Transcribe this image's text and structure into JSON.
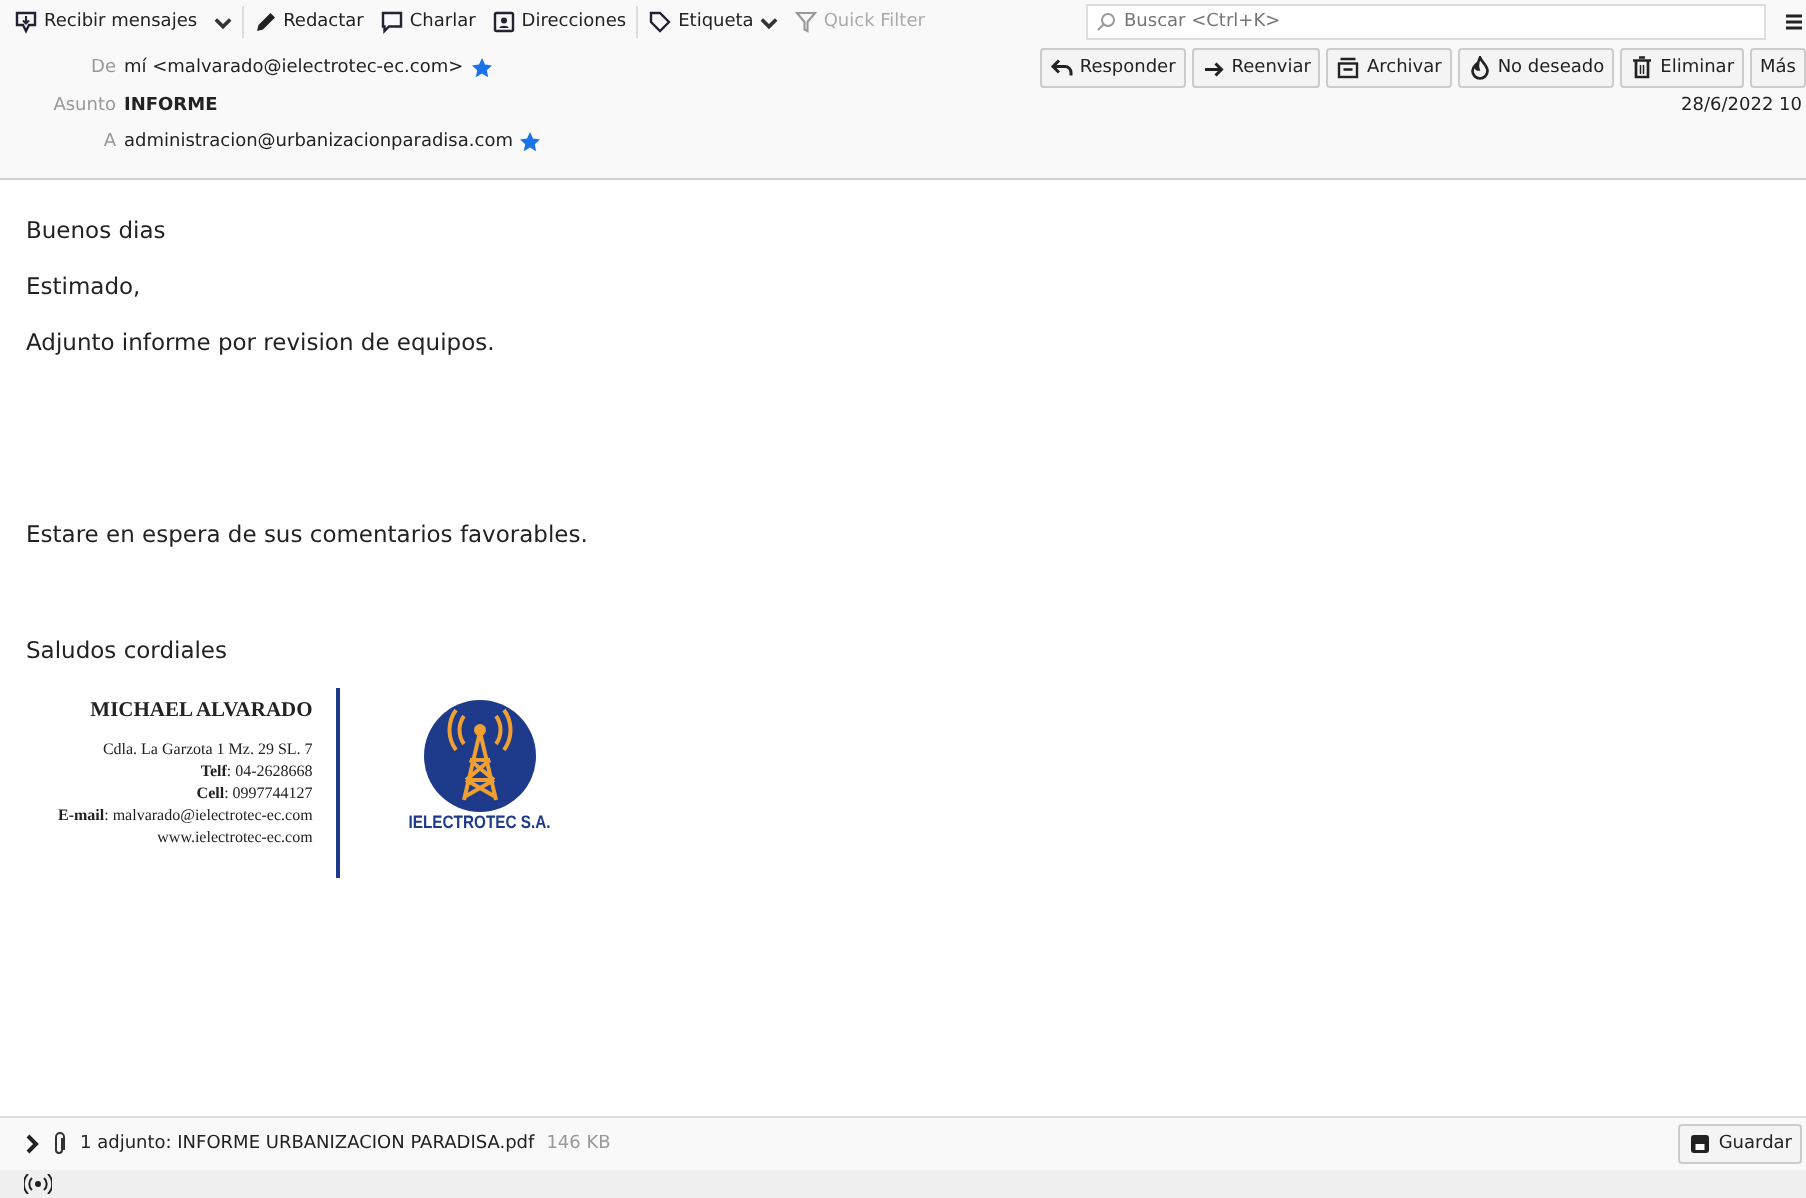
{
  "toolbar": {
    "buttons": [
      {
        "kind": "get",
        "label": "Recibir mensajes"
      },
      {
        "kind": "dropdown"
      },
      {
        "kind": "compose",
        "label": "Redactar"
      },
      {
        "kind": "chat",
        "label": "Charlar"
      },
      {
        "kind": "contacts",
        "label": "Direcciones"
      },
      {
        "kind": "tag",
        "label": "Etiqueta"
      },
      {
        "kind": "filter",
        "label": "Quick Filter"
      }
    ],
    "search": {
      "placeholder": "Buscar <Ctrl+K>"
    }
  },
  "header": {
    "from_label": "De",
    "from": "mí <malvarado@ielectrotec-ec.com>",
    "subject_label": "Asunto",
    "subject": "INFORME",
    "to_label": "A",
    "to": "administracion@urbanizacionparadisa.com",
    "date": "28/6/2022 10",
    "actions": [
      {
        "kind": "reply",
        "label": "Responder"
      },
      {
        "kind": "forward",
        "label": "Reenviar"
      },
      {
        "kind": "archive",
        "label": "Archivar"
      },
      {
        "kind": "junk",
        "label": "No deseado"
      },
      {
        "kind": "delete",
        "label": "Eliminar"
      },
      {
        "kind": "more",
        "label": "Más"
      }
    ]
  },
  "body": [
    "Buenos dias",
    "Estimado,",
    "Adjunto informe por revision de equipos.",
    "Estare en espera de sus comentarios favorables.",
    "Saludos cordiales"
  ],
  "signature": {
    "name": "MICHAEL ALVARADO",
    "address": "Cdla. La Garzota 1 Mz. 29 SL. 7",
    "phone": "**Telf**: 04-2628668",
    "cell": "**Cell**: 0997744127",
    "email": "**E-mail**: malvarado@ielectrotec-ec.com",
    "web": "www.ielectrotec-ec.com",
    "company": "IELECTROTEC S.A."
  },
  "attachment": {
    "label": "1 adjunto: INFORME URBANIZACION PARADISA.pdf",
    "size": "146 KB",
    "save": "Guardar"
  }
}
